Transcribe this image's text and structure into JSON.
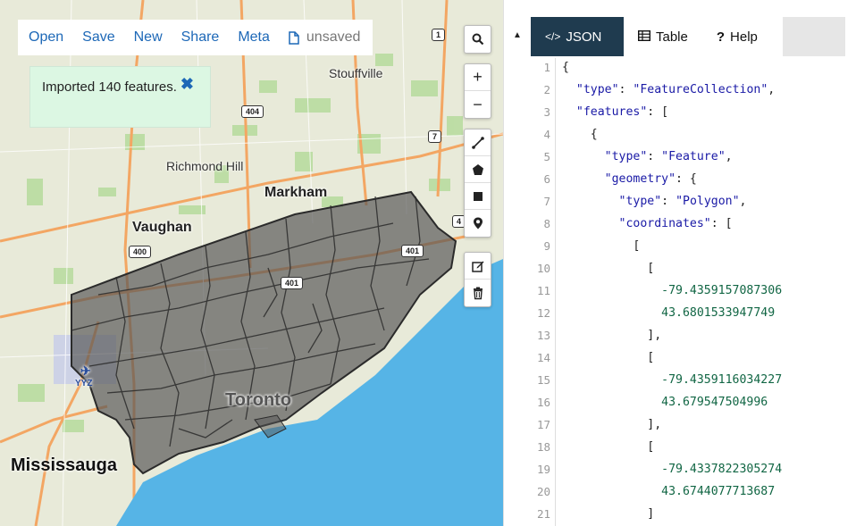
{
  "menu": {
    "open": "Open",
    "save": "Save",
    "new": "New",
    "share": "Share",
    "meta": "Meta",
    "status": "unsaved",
    "status_icon": "document-icon"
  },
  "notice": {
    "text": "Imported 140 features.",
    "close_icon": "close-icon"
  },
  "map": {
    "labels": {
      "stouffville": "Stouffville",
      "richmond_hill": "Richmond Hill",
      "markham": "Markham",
      "vaughan": "Vaughan",
      "toronto": "Toronto",
      "mississauga": "Mississauga",
      "yyz": "YYZ"
    },
    "shields": {
      "hwy_1": "1",
      "hwy_404_a": "404",
      "hwy_7": "7",
      "hwy_400": "400",
      "hwy_401_a": "401",
      "hwy_401_b": "401",
      "hwy_4": "4"
    },
    "controls": {
      "search": "search-icon",
      "zoom_in": "+",
      "zoom_out": "−",
      "draw_line": "line-icon",
      "draw_polygon": "polygon-icon",
      "draw_rectangle": "rectangle-icon",
      "draw_marker": "marker-icon",
      "edit": "edit-icon",
      "delete": "trash-icon"
    },
    "colors": {
      "water": "#56b4e6",
      "land": "#e8ead9",
      "park": "#b9dca0",
      "highway": "#f3a663",
      "polygon_fill": "#555555"
    }
  },
  "divider": {
    "collapse_icon": "collapse-up-icon"
  },
  "editor": {
    "tabs": [
      {
        "label": "JSON",
        "icon": "</>",
        "active": true
      },
      {
        "label": "Table",
        "icon": "table-icon",
        "active": false
      },
      {
        "label": "Help",
        "icon": "?",
        "active": false
      }
    ],
    "lines": [
      {
        "n": "1",
        "text": "{"
      },
      {
        "n": "2",
        "text": "  \"type\": \"FeatureCollection\","
      },
      {
        "n": "3",
        "text": "  \"features\": ["
      },
      {
        "n": "4",
        "text": "    {"
      },
      {
        "n": "5",
        "text": "      \"type\": \"Feature\","
      },
      {
        "n": "6",
        "text": "      \"geometry\": {"
      },
      {
        "n": "7",
        "text": "        \"type\": \"Polygon\","
      },
      {
        "n": "8",
        "text": "        \"coordinates\": ["
      },
      {
        "n": "9",
        "text": "          ["
      },
      {
        "n": "10",
        "text": "            ["
      },
      {
        "n": "11",
        "text": "              -79.4359157087306"
      },
      {
        "n": "12",
        "text": "              43.6801533947749"
      },
      {
        "n": "13",
        "text": "            ],"
      },
      {
        "n": "14",
        "text": "            ["
      },
      {
        "n": "15",
        "text": "              -79.4359116034227"
      },
      {
        "n": "16",
        "text": "              43.679547504996"
      },
      {
        "n": "17",
        "text": "            ],"
      },
      {
        "n": "18",
        "text": "            ["
      },
      {
        "n": "19",
        "text": "              -79.4337822305274"
      },
      {
        "n": "20",
        "text": "              43.6744077713687"
      },
      {
        "n": "21",
        "text": "            ]"
      }
    ]
  }
}
